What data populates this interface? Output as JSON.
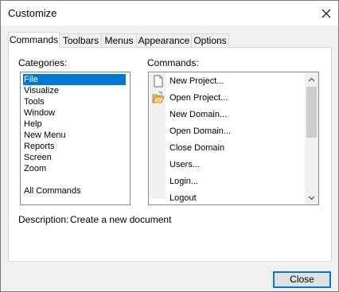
{
  "window": {
    "title": "Customize"
  },
  "tabs": [
    {
      "label": "Commands"
    },
    {
      "label": "Toolbars"
    },
    {
      "label": "Menus"
    },
    {
      "label": "Appearance"
    },
    {
      "label": "Options"
    }
  ],
  "categories": {
    "label": "Categories:",
    "selected": "File",
    "items": [
      "File",
      "Visualize",
      "Tools",
      "Window",
      "Help",
      "New Menu",
      "Reports",
      "Screen",
      "Zoom",
      "",
      "All Commands"
    ]
  },
  "commands": {
    "label": "Commands:",
    "items": [
      {
        "label": "New Project...",
        "icon": "new-document-icon"
      },
      {
        "label": "Open Project...",
        "icon": "open-folder-icon"
      },
      {
        "label": "New Domain...",
        "icon": ""
      },
      {
        "label": "Open Domain...",
        "icon": ""
      },
      {
        "label": "Close Domain",
        "icon": ""
      },
      {
        "label": "Users...",
        "icon": ""
      },
      {
        "label": "Login...",
        "icon": ""
      },
      {
        "label": "Logout",
        "icon": ""
      }
    ]
  },
  "description": {
    "label": "Description:",
    "text": "Create a new document"
  },
  "buttons": {
    "close": "Close"
  },
  "colors": {
    "selection": "#0078d7",
    "focus_border": "#0078d7"
  }
}
